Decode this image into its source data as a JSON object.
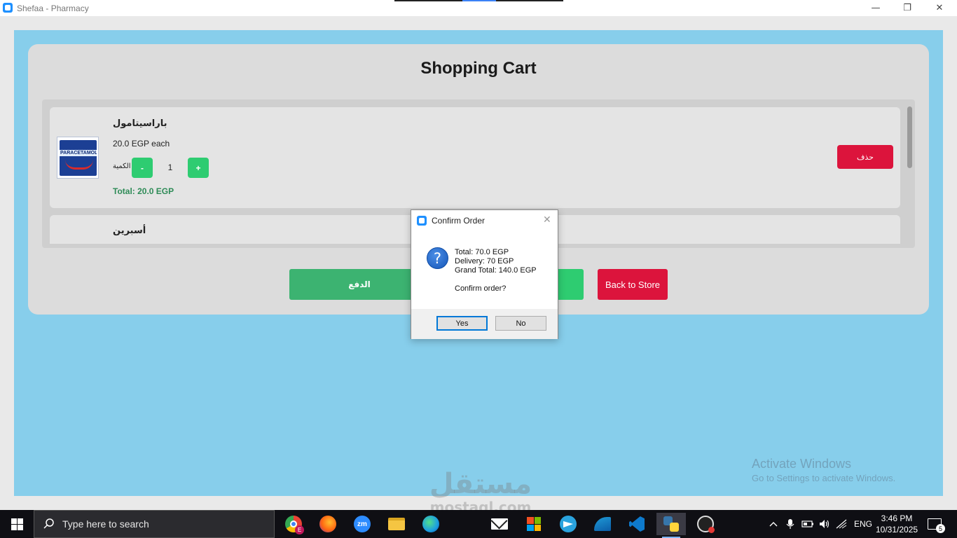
{
  "window": {
    "title": "Shefaa - Pharmacy",
    "minimize_glyph": "—",
    "restore_glyph": "❐",
    "close_glyph": "✕"
  },
  "cart": {
    "title": "Shopping Cart",
    "items": [
      {
        "name": "باراسيتامول",
        "image_label": "PARACETAMOL",
        "price": "20.0 EGP each",
        "qty_label": "الكمية",
        "minus": "-",
        "qty": "1",
        "plus": "+",
        "total": "Total: 20.0 EGP",
        "delete_label": "حذف"
      },
      {
        "name": "أسبرين"
      }
    ],
    "pay_label": "الدفع",
    "back_label": "Back to Store"
  },
  "dialog": {
    "title": "Confirm Order",
    "close_glyph": "✕",
    "question_glyph": "?",
    "lines": [
      "Total: 70.0 EGP",
      "Delivery: 70 EGP",
      "Grand Total: 140.0 EGP"
    ],
    "confirm": "Confirm order?",
    "yes": "Yes",
    "no": "No"
  },
  "overlay": {
    "activate_title": "Activate Windows",
    "activate_sub": "Go to Settings to activate Windows.",
    "watermark_ar": "مستقل",
    "watermark_en": "mostaql.com"
  },
  "taskbar": {
    "search_placeholder": "Type here to search",
    "language": "ENG",
    "time": "3:46 PM",
    "date": "10/31/2025",
    "notification_count": "5",
    "chrome_badge": "E",
    "zoom_label": "zm"
  },
  "colors": {
    "background": "#87ceeb",
    "card": "#dcdcdc",
    "green": "#2ecc71",
    "pay_green": "#3cb371",
    "red": "#dc143c",
    "total_green": "#2e8b57"
  }
}
